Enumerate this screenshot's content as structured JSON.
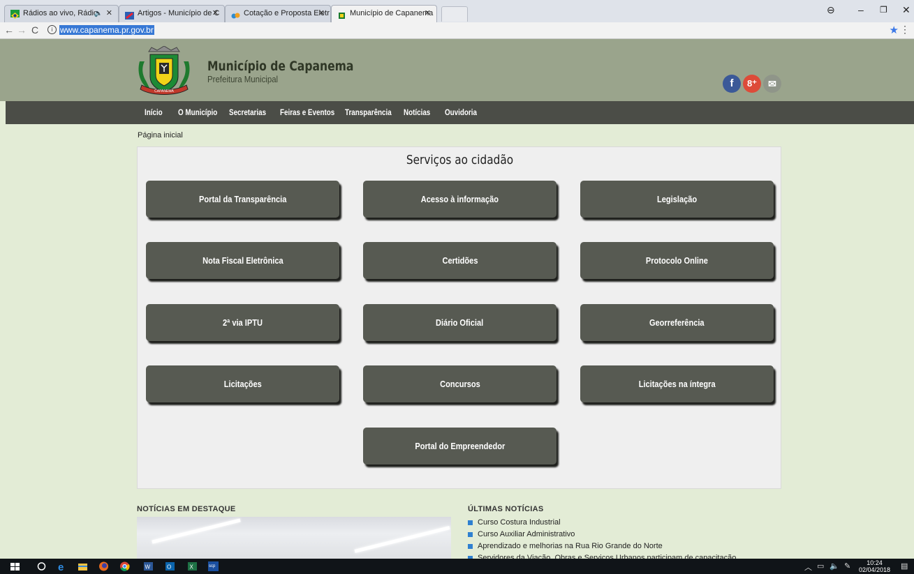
{
  "browser": {
    "tabs": [
      {
        "label": "Rádios ao vivo, Rádio",
        "audio": "🔈",
        "close": "✕"
      },
      {
        "label": "Artigos - Município de C",
        "close": "✕"
      },
      {
        "label": "Cotação e Proposta Eletr",
        "close": "✕"
      },
      {
        "label": "Município de Capanema",
        "close": "✕"
      }
    ],
    "url": "www.capanema.pr.gov.br",
    "window_controls": {
      "account": "⊖",
      "minimize": "–",
      "restore": "❐",
      "close": "✕"
    }
  },
  "site": {
    "title": "Município de Capanema",
    "subtitle": "Prefeitura Municipal",
    "crest_banner": "CAPANEMA",
    "social": {
      "facebook": "f",
      "googleplus": "8⁺",
      "email": "✉"
    }
  },
  "menu": [
    "Início",
    "O Município",
    "Secretarias",
    "Feiras e Eventos",
    "Transparência",
    "Notícias",
    "Ouvidoria"
  ],
  "breadcrumb": "Página inicial",
  "services": {
    "title": "Serviços ao cidadão",
    "buttons": [
      "Portal da Transparência",
      "Acesso à informação",
      "Legislação",
      "Nota Fiscal Eletrônica",
      "Certidões",
      "Protocolo Online",
      "2ª via IPTU",
      "Diário Oficial",
      "Georreferência",
      "Licitações",
      "Concursos",
      "Licitações na íntegra",
      "Portal do Empreendedor"
    ]
  },
  "news": {
    "featured_heading": "NOTÍCIAS EM DESTAQUE",
    "latest_heading": "ÚLTIMAS NOTÍCIAS",
    "latest": [
      "Curso Costura Industrial",
      "Curso Auxiliar Administrativo",
      "Aprendizado e melhorias na Rua Rio Grande do Norte",
      "Servidores da Viação, Obras e Serviços Urbanos participam de capacitação"
    ]
  },
  "taskbar": {
    "time": "10:24",
    "date": "02/04/2018"
  },
  "colors": {
    "header_bg": "#9aa48c",
    "menu_bg": "#4b4d47",
    "button_bg": "#575a52",
    "page_bg": "#e3ecd6",
    "facebook": "#3b5998",
    "googleplus": "#dd4b39",
    "email": "#8f9589"
  }
}
